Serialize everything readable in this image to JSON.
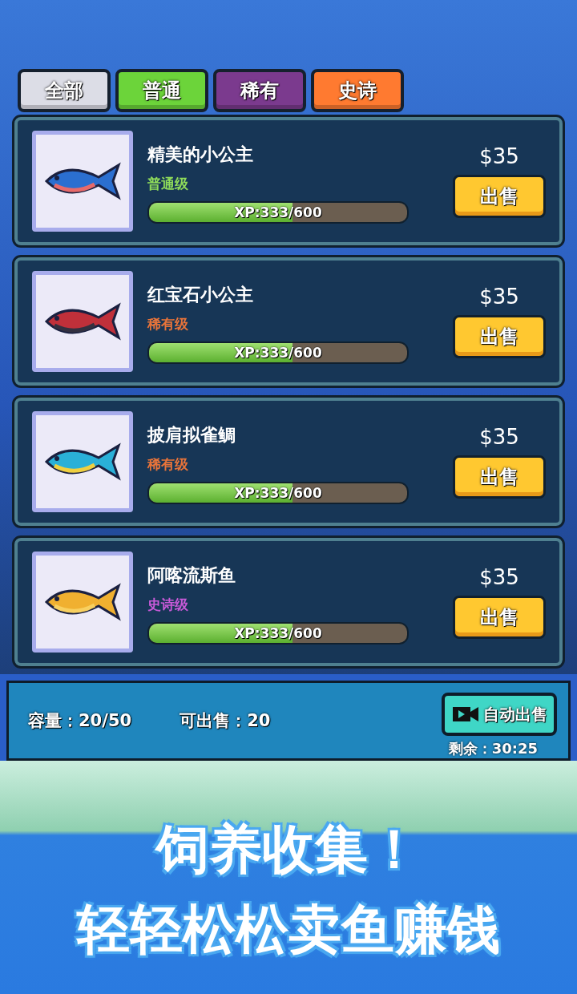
{
  "tabs": [
    {
      "label": "全部",
      "color": "#dcdde6"
    },
    {
      "label": "普通",
      "color": "#6cd43a"
    },
    {
      "label": "稀有",
      "color": "#7b3a8e"
    },
    {
      "label": "史诗",
      "color": "#ff7a30"
    }
  ],
  "fish": [
    {
      "name": "精美的小公主",
      "rarity": "普通级",
      "color": "#8fdc5a",
      "xp": "XP:333/600",
      "level": 0.555,
      "price": "$35",
      "sell": "出售"
    },
    {
      "name": "红宝石小公主",
      "rarity": "稀有级",
      "color": "#e8743a",
      "xp": "XP:333/600",
      "level": 0.555,
      "price": "$35",
      "sell": "出售"
    },
    {
      "name": "披肩拟雀鲷",
      "rarity": "稀有级",
      "color": "#e8743a",
      "xp": "XP:333/600",
      "level": 0.555,
      "price": "$35",
      "sell": "出售"
    },
    {
      "name": "阿喀流斯鱼",
      "rarity": "史诗级",
      "color": "#c85ad8",
      "xp": "XP:333/600",
      "level": 0.555,
      "price": "$35",
      "sell": "出售"
    }
  ],
  "footer": {
    "capacity": "容量：20/50",
    "sellable": "可出售：20",
    "auto_sell": "自动出售",
    "remaining": "剩余：30:25"
  },
  "promo": {
    "line_1": "饲养收集！",
    "line_2": "轻轻松松卖鱼赚钱"
  }
}
